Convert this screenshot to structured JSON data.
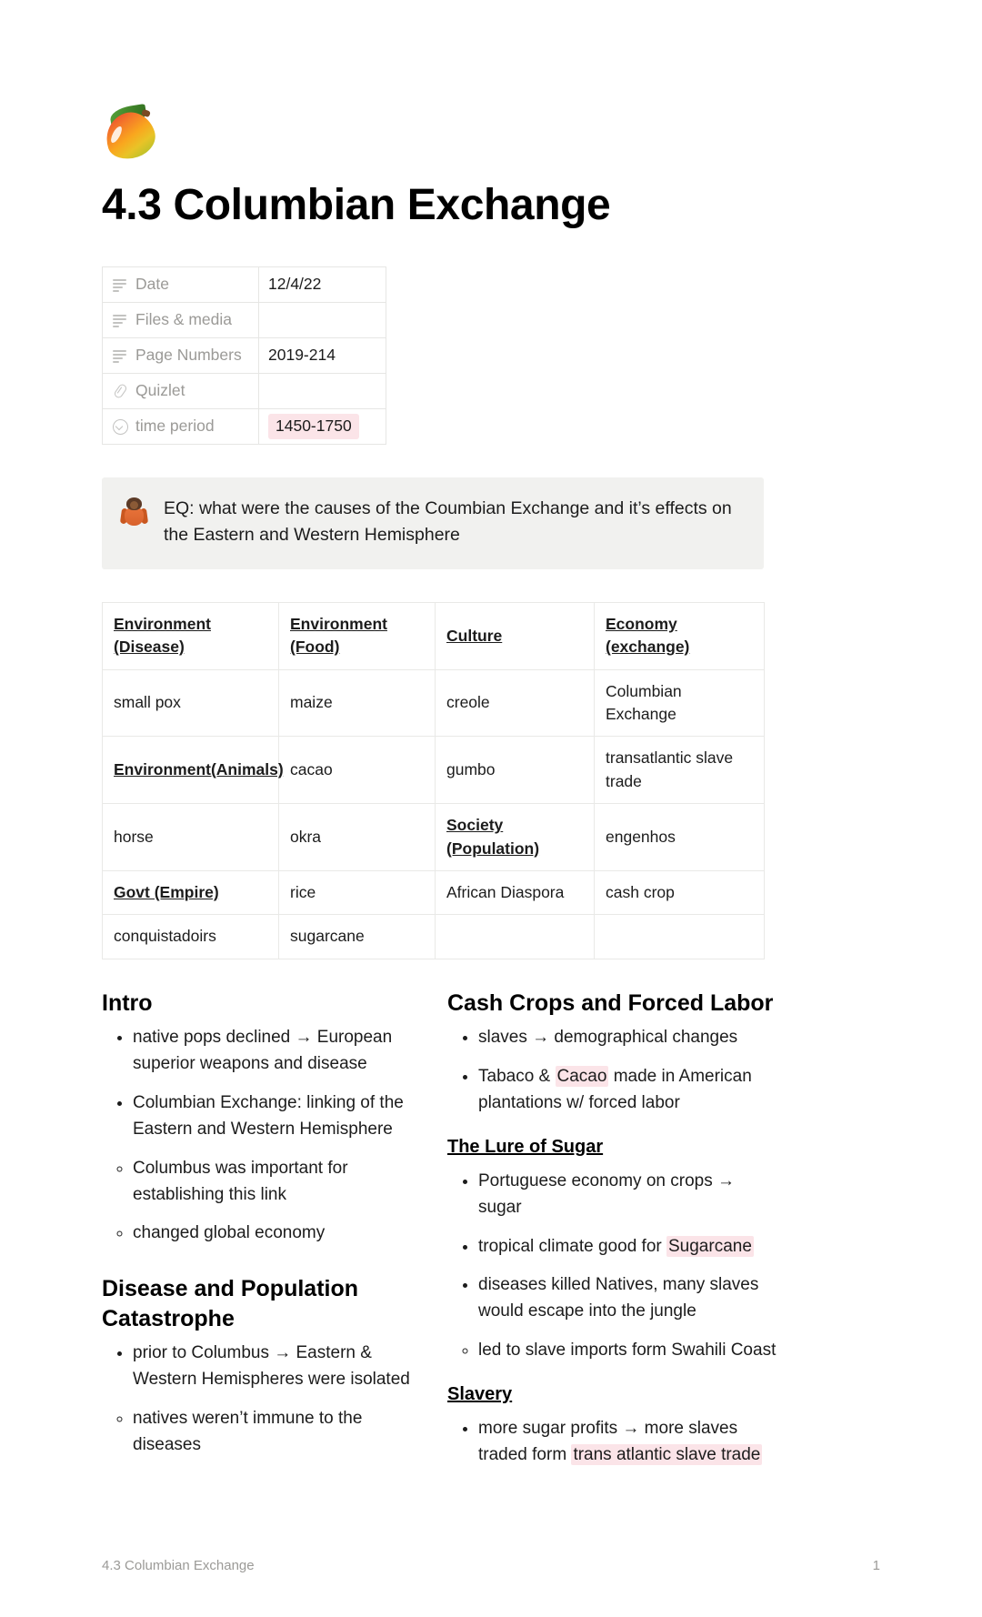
{
  "page": {
    "icon": "mango-emoji",
    "title": "4.3 Columbian Exchange"
  },
  "properties": [
    {
      "icon": "text-icon",
      "label": "Date",
      "value": "12/4/22",
      "value_type": "plain"
    },
    {
      "icon": "text-icon",
      "label": "Files & media",
      "value": "",
      "value_type": "plain"
    },
    {
      "icon": "text-icon",
      "label": "Page Numbers",
      "value": "2019-214",
      "value_type": "plain"
    },
    {
      "icon": "clip-icon",
      "label": "Quizlet",
      "value": "",
      "value_type": "plain"
    },
    {
      "icon": "select-icon",
      "label": "time period",
      "value": "1450-1750",
      "value_type": "tag"
    }
  ],
  "callout": {
    "icon": "orangutan-emoji",
    "text": "EQ: what were the causes of the Coumbian Exchange and it’s effects on the Eastern and Western Hemisphere",
    "background": "#f1f1ef"
  },
  "grid_table": {
    "headers": [
      "Environment (Disease)",
      "Environment (Food)",
      "Culture",
      "Economy (exchange)"
    ],
    "header_lines": [
      [
        "Environment",
        "(Disease)"
      ],
      [
        "Environment",
        "(Food)"
      ],
      [
        "Culture"
      ],
      [
        "Economy (exchange)"
      ]
    ],
    "rows": [
      [
        {
          "text": "small pox",
          "style": "plain"
        },
        {
          "text": "maize",
          "style": "plain"
        },
        {
          "text": "creole",
          "style": "plain"
        },
        {
          "text": "Columbian Exchange",
          "style": "plain"
        }
      ],
      [
        {
          "text": "Environment(Animals)",
          "style": "underline-bold"
        },
        {
          "text": "cacao",
          "style": "plain"
        },
        {
          "text": "gumbo",
          "style": "plain"
        },
        {
          "text": "transatlantic slave trade",
          "style": "plain"
        }
      ],
      [
        {
          "text": "horse",
          "style": "plain"
        },
        {
          "text": "okra",
          "style": "plain"
        },
        {
          "text": "Society (Population)",
          "style": "underline-bold",
          "lines": [
            "Society",
            "(Population)"
          ]
        },
        {
          "text": "engenhos",
          "style": "plain"
        }
      ],
      [
        {
          "text": "Govt (Empire)",
          "style": "underline-bold"
        },
        {
          "text": "rice",
          "style": "plain"
        },
        {
          "text": "African Diaspora",
          "style": "plain"
        },
        {
          "text": "cash crop",
          "style": "plain"
        }
      ],
      [
        {
          "text": "conquistadoirs",
          "style": "plain"
        },
        {
          "text": "sugarcane",
          "style": "plain"
        },
        {
          "text": "",
          "style": "plain"
        },
        {
          "text": "",
          "style": "plain"
        }
      ]
    ]
  },
  "left_column": {
    "heading_intro": "Intro",
    "intro_bullets": [
      "native pops declined → European superior weapons and disease",
      "Columbian Exchange: linking of the Eastern and Western Hemisphere"
    ],
    "intro_subbullets": [
      "Columbus was important for establishing this link",
      "changed global economy"
    ],
    "heading_disease": "Disease and Population Catastrophe",
    "disease_bullets": [
      "prior to Columbus → Eastern & Western Hemispheres were isolated"
    ],
    "disease_subbullets": [
      "natives weren’t immune to the diseases"
    ]
  },
  "right_column": {
    "heading_cash_crops": "Cash Crops and Forced Labor",
    "cash_bullet_1": "slaves → demographical changes",
    "cash_bullet_2_pre": "Tabaco & ",
    "cash_bullet_2_hl": "Cacao",
    "cash_bullet_2_post": " made in American plantations w/ forced labor",
    "heading_lure_of_sugar": "The Lure of Sugar",
    "sugar_bullet_1": "Portuguese economy on crops → sugar",
    "sugar_bullet_2_pre": "tropical climate good for ",
    "sugar_bullet_2_hl": "Sugarcane",
    "sugar_bullet_3": "diseases killed Natives, many slaves would escape into the jungle",
    "sugar_subbullet_1": "led to slave imports form Swahili Coast",
    "heading_slavery": "Slavery",
    "slavery_bullet_pre": "more sugar profits → more slaves traded form ",
    "slavery_bullet_hl": "trans atlantic slave trade"
  },
  "footer": {
    "left": "4.3 Columbian Exchange",
    "right": "1"
  },
  "colors": {
    "highlight_pink": "#fbe4e8",
    "callout_bg": "#f1f1ef",
    "muted_text": "#9b9a97",
    "border": "#e9e9e7"
  }
}
